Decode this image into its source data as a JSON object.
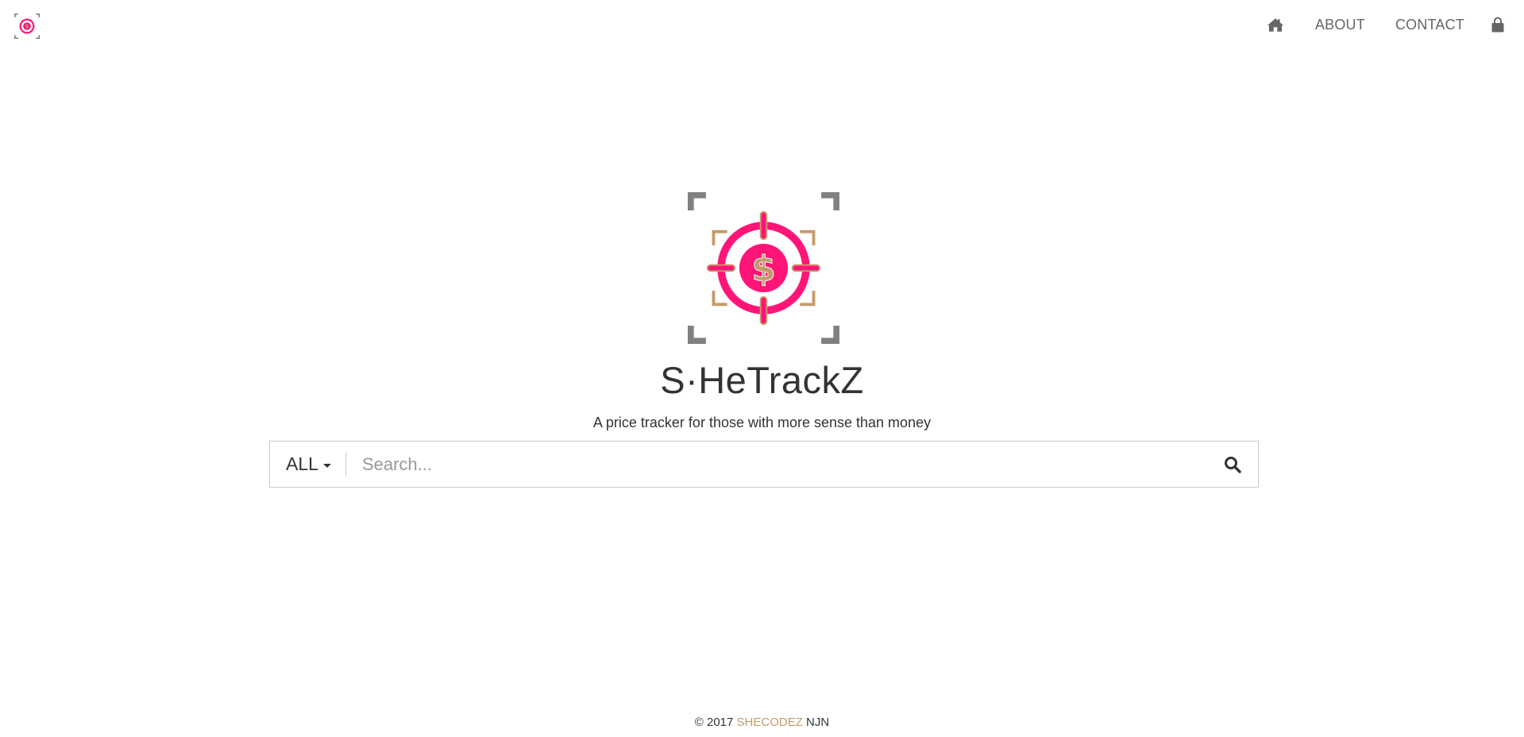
{
  "navbar": {
    "brand_icon": "target-dollar-logo-icon",
    "items": {
      "home_icon": "home-icon",
      "about_label": "ABOUT",
      "contact_label": "CONTACT",
      "lock_icon": "lock-icon"
    }
  },
  "hero": {
    "logo_icon": "target-dollar-logo-icon",
    "title": "S·HeTrackZ",
    "tagline": "A price tracker for those with more sense than money"
  },
  "search": {
    "category_selected": "ALL",
    "placeholder": "Search...",
    "value": "",
    "button_icon": "search-icon"
  },
  "footer": {
    "copyright": "© 2017",
    "brand": "SHECODEZ",
    "suffix": "NJN"
  },
  "colors": {
    "brand_pink": "#ff1478",
    "brand_tan": "#c49a6c",
    "frame_gray": "#808080",
    "nav_text": "#666666",
    "text": "#333333"
  }
}
